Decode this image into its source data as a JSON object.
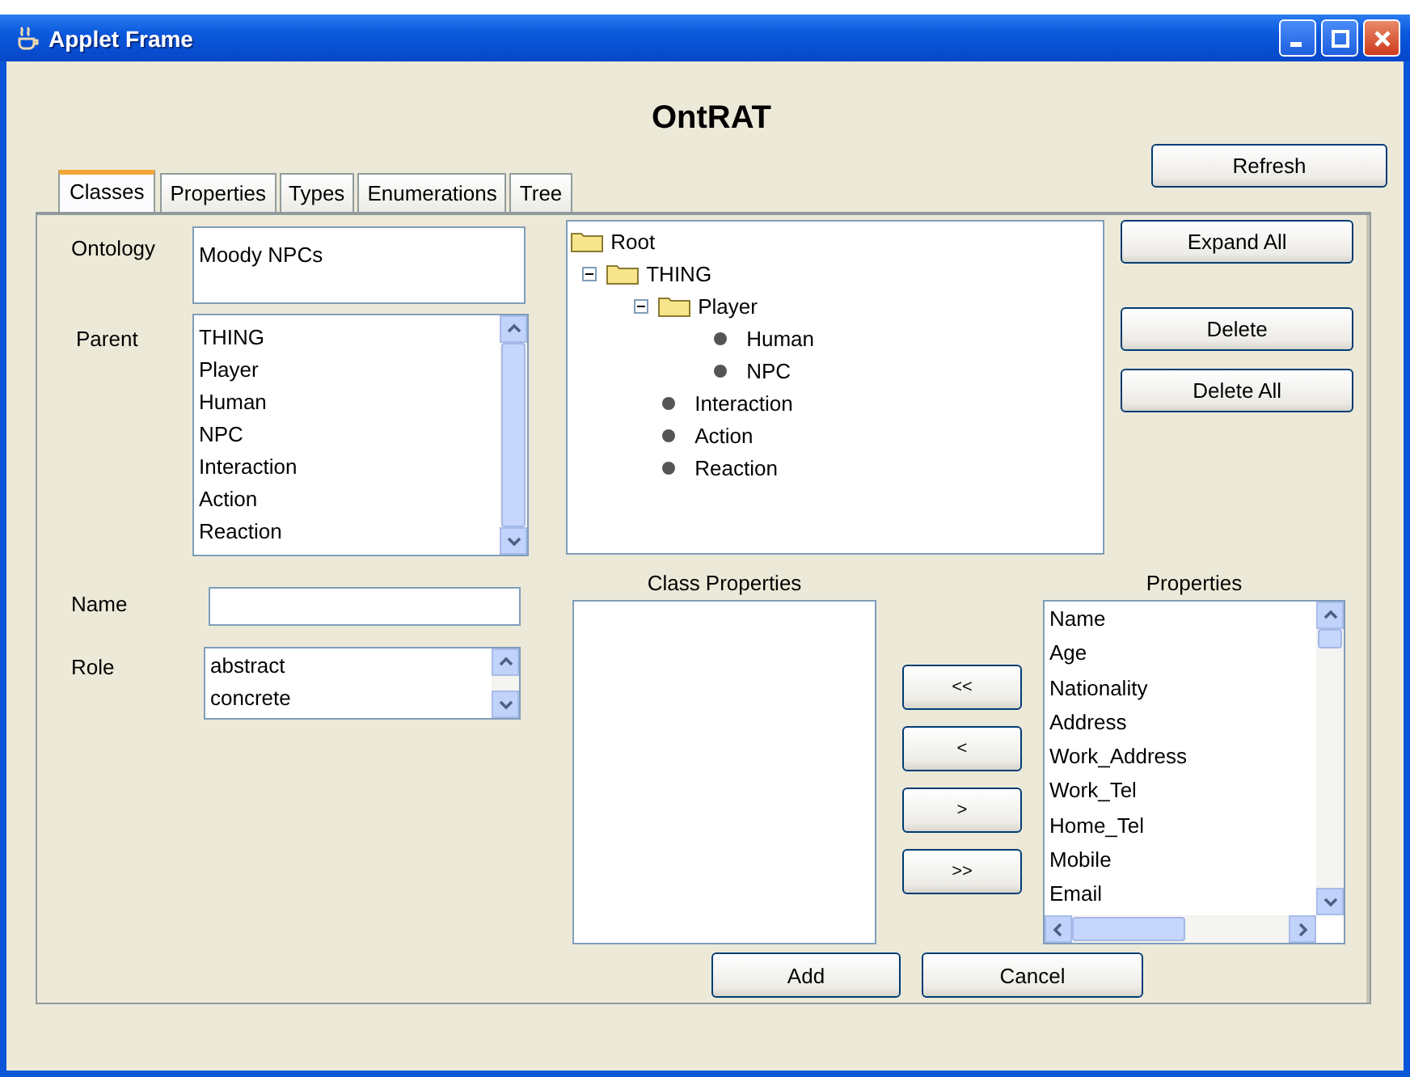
{
  "window": {
    "title": "Applet Frame"
  },
  "heading": "OntRAT",
  "tabs": [
    {
      "label": "Classes",
      "selected": true
    },
    {
      "label": "Properties",
      "selected": false
    },
    {
      "label": "Types",
      "selected": false
    },
    {
      "label": "Enumerations",
      "selected": false
    },
    {
      "label": "Tree",
      "selected": false
    }
  ],
  "refresh_button": "Refresh",
  "form": {
    "ontology": {
      "label": "Ontology",
      "value": "Moody NPCs"
    },
    "parent": {
      "label": "Parent",
      "items": [
        {
          "label": "THING",
          "selected": false
        },
        {
          "label": "Player",
          "selected": false
        },
        {
          "label": "Human",
          "selected": false
        },
        {
          "label": "NPC",
          "selected": false
        },
        {
          "label": "Interaction",
          "selected": false
        },
        {
          "label": "Action",
          "selected": false
        },
        {
          "label": "Reaction",
          "selected": false
        }
      ]
    },
    "name": {
      "label": "Name"
    },
    "role": {
      "label": "Role",
      "items": [
        {
          "label": "abstract",
          "selected": false
        },
        {
          "label": "concrete",
          "selected": false
        }
      ]
    }
  },
  "tree": [
    {
      "label": "Root",
      "kind": "folder",
      "children": [
        {
          "label": "THING",
          "kind": "folder",
          "expanded": true,
          "children": [
            {
              "label": "Player",
              "kind": "folder",
              "expanded": true,
              "children": [
                {
                  "label": "Human",
                  "kind": "leaf"
                },
                {
                  "label": "NPC",
                  "kind": "leaf"
                }
              ]
            },
            {
              "label": "Interaction",
              "kind": "leaf"
            },
            {
              "label": "Action",
              "kind": "leaf"
            },
            {
              "label": "Reaction",
              "kind": "leaf"
            }
          ]
        }
      ]
    }
  ],
  "tree_buttons": [
    "Expand All",
    "Delete",
    "Delete All"
  ],
  "class_properties": {
    "title": "Class Properties"
  },
  "move_buttons": [
    "<<",
    "<",
    ">",
    ">>"
  ],
  "properties": {
    "title": "Properties",
    "items": [
      {
        "label": "Name",
        "selected": false
      },
      {
        "label": "Age",
        "selected": false
      },
      {
        "label": "Nationality",
        "selected": false
      },
      {
        "label": "Address",
        "selected": false
      },
      {
        "label": "Work_Address",
        "selected": false
      },
      {
        "label": "Work_Tel",
        "selected": false
      },
      {
        "label": "Home_Tel",
        "selected": false
      },
      {
        "label": "Mobile",
        "selected": false
      },
      {
        "label": "Email",
        "selected": false
      }
    ]
  },
  "footer_buttons": [
    "Add",
    "Cancel"
  ]
}
